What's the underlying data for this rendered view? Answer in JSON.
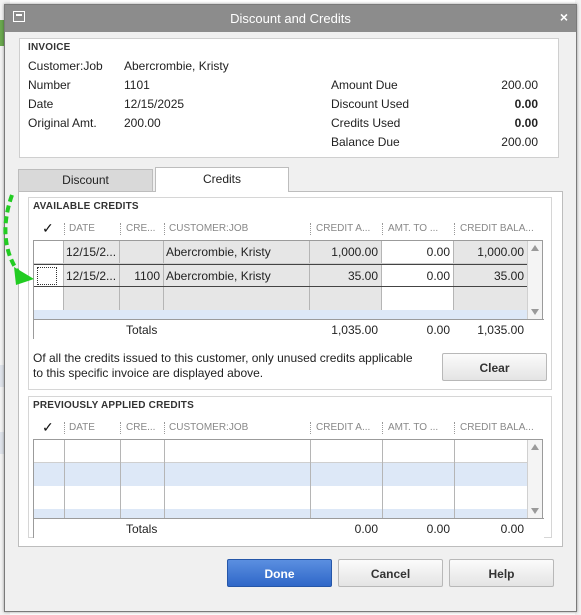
{
  "window": {
    "title": "Discount and Credits",
    "close_glyph": "×"
  },
  "invoice": {
    "section_title": "INVOICE",
    "customer_job_label": "Customer:Job",
    "customer_job_value": "Abercrombie, Kristy",
    "number_label": "Number",
    "number_value": "1101",
    "date_label": "Date",
    "date_value": "12/15/2025",
    "original_amt_label": "Original Amt.",
    "original_amt_value": "200.00",
    "amount_due_label": "Amount Due",
    "amount_due_value": "200.00",
    "discount_used_label": "Discount Used",
    "discount_used_value": "0.00",
    "credits_used_label": "Credits Used",
    "credits_used_value": "0.00",
    "balance_due_label": "Balance Due",
    "balance_due_value": "200.00"
  },
  "tabs": {
    "discount": "Discount",
    "credits": "Credits"
  },
  "available_credits": {
    "section_title": "AVAILABLE CREDITS",
    "columns": [
      "✓",
      "DATE",
      "CRE...",
      "CUSTOMER:JOB",
      "CREDIT A...",
      "AMT. TO ...",
      "CREDIT BALA..."
    ],
    "rows": [
      {
        "date": "12/15/2...",
        "credit_no": "",
        "customer_job": "Abercrombie, Kristy",
        "credit_amt": "1,000.00",
        "amt_to_use": "0.00",
        "credit_balance": "1,000.00"
      },
      {
        "date": "12/15/2...",
        "credit_no": "1100",
        "customer_job": "Abercrombie, Kristy",
        "credit_amt": "35.00",
        "amt_to_use": "0.00",
        "credit_balance": "35.00"
      }
    ],
    "totals_label": "Totals",
    "totals": {
      "credit_amt": "1,035.00",
      "amt_to_use": "0.00",
      "credit_balance": "1,035.00"
    },
    "note": "Of all the credits issued to this customer, only unused credits applicable to this specific invoice are displayed above.",
    "clear_button": "Clear"
  },
  "previously_applied": {
    "section_title": "PREVIOUSLY APPLIED CREDITS",
    "columns": [
      "✓",
      "DATE",
      "CRE...",
      "CUSTOMER:JOB",
      "CREDIT A...",
      "AMT. TO ...",
      "CREDIT BALA..."
    ],
    "totals_label": "Totals",
    "totals": {
      "credit_amt": "0.00",
      "amt_to_use": "0.00",
      "credit_balance": "0.00"
    }
  },
  "buttons": {
    "done": "Done",
    "cancel": "Cancel",
    "help": "Help"
  },
  "colors": {
    "titlebar": "#8c8c8c",
    "primary_button": "#2f67c8",
    "annotation_arrow": "#22cc22",
    "row_shade": "#e6e6e6",
    "row_blue": "#dde8f7"
  }
}
